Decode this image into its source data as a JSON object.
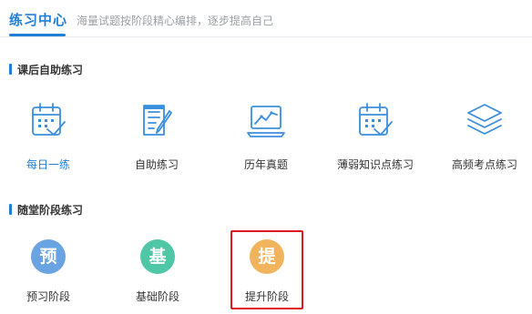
{
  "header": {
    "title": "练习中心",
    "subtitle": "海量试题按阶段精心编排，逐步提高自己"
  },
  "sections": [
    {
      "title": "课后自助练习"
    },
    {
      "title": "随堂阶段练习"
    }
  ],
  "tools": [
    {
      "label": "每日一练",
      "icon": "calendar-check-icon",
      "active": true
    },
    {
      "label": "自助练习",
      "icon": "document-pen-icon"
    },
    {
      "label": "历年真题",
      "icon": "laptop-chart-icon"
    },
    {
      "label": "薄弱知识点练习",
      "icon": "calendar-check-icon"
    },
    {
      "label": "高频考点练习",
      "icon": "layers-icon"
    }
  ],
  "stages": [
    {
      "glyph": "预",
      "label": "预习阶段",
      "color": "#6aa3e2"
    },
    {
      "glyph": "基",
      "label": "基础阶段",
      "color": "#4fc6a5"
    },
    {
      "glyph": "提",
      "label": "提升阶段",
      "color": "#f1b35b",
      "selected": true
    }
  ],
  "colors": {
    "accent": "#1f7fd6",
    "icon_stroke": "#3b8fdc",
    "selection_border": "#e0191a"
  }
}
